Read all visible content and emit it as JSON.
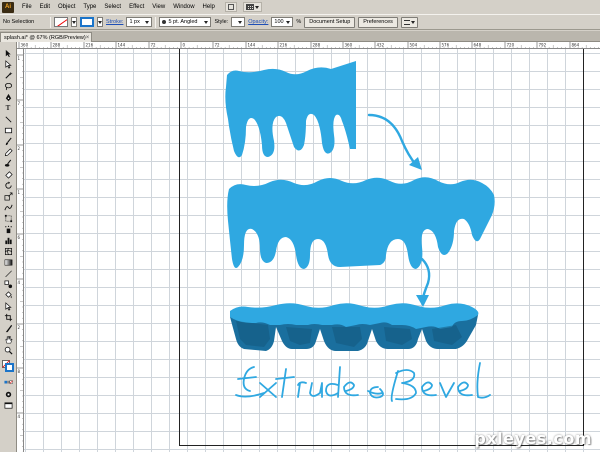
{
  "app": {
    "logo": "Ai"
  },
  "menu": {
    "items": [
      "File",
      "Edit",
      "Object",
      "Type",
      "Select",
      "Effect",
      "View",
      "Window",
      "Help"
    ]
  },
  "control_bar": {
    "selection_label": "No Selection",
    "stroke_label": "Stroke:",
    "stroke_weight": "1 px",
    "brush_label": "5 pt. Angled",
    "style_label": "Style:",
    "opacity_label": "Opacity:",
    "opacity_value": "100",
    "opacity_unit": "%",
    "document_setup_button": "Document Setup",
    "preferences_button": "Preferences"
  },
  "document_tab": {
    "title": "splash.ai* @ 67% (RGB/Preview)",
    "close": "×"
  },
  "rulers": {
    "top_labels": [
      "360",
      "288",
      "216",
      "144",
      "72",
      "0",
      "72",
      "144",
      "216",
      "288",
      "360",
      "432",
      "504",
      "576",
      "648",
      "720",
      "792",
      "864"
    ],
    "left_labels": [
      "1",
      "7",
      "2",
      "1",
      "6",
      "4",
      "2",
      "8",
      "4"
    ]
  },
  "artwork": {
    "caption": "Extrude & Bevel",
    "fill_color": "#2fa8e1",
    "extrude_side_color": "#1a6f9e",
    "arrow_color": "#2fa8e1"
  },
  "watermark": "pxleyes.com"
}
